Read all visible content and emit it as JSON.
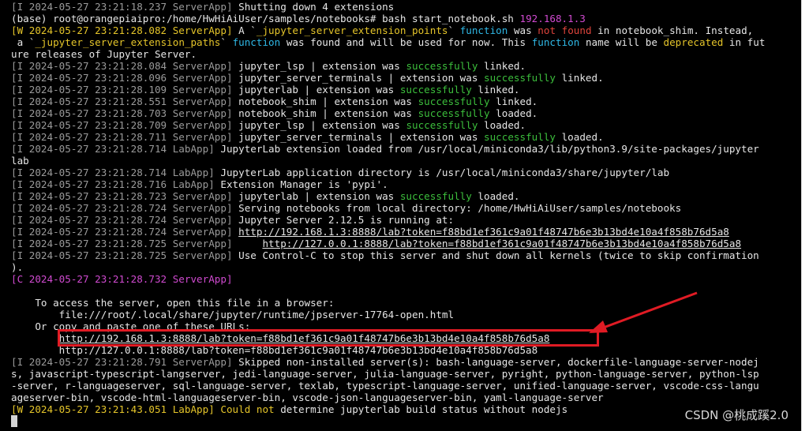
{
  "terminal": {
    "lines": [
      [
        {
          "t": "[I 2024-05-27 23:21:18.237 ServerApp] ",
          "c": "gray"
        },
        {
          "t": "Shutting down 4 extensions",
          "c": "white"
        }
      ],
      [
        {
          "t": "(base) root@orangepiaipro:/home/HwHiAiUser/samples/notebooks# bash start_notebook.sh ",
          "c": "white"
        },
        {
          "t": "192.168.1.3",
          "c": "mag"
        }
      ],
      [
        {
          "t": "[W 2024-05-27 23:21:28.082 ServerApp] ",
          "c": "yellow"
        },
        {
          "t": "A `",
          "c": "white"
        },
        {
          "t": "_jupyter_server_extension_points",
          "c": "yellow"
        },
        {
          "t": "` ",
          "c": "white"
        },
        {
          "t": "function",
          "c": "cyan"
        },
        {
          "t": " was ",
          "c": "white"
        },
        {
          "t": "not found",
          "c": "red"
        },
        {
          "t": " in notebook_shim. Instead,",
          "c": "white"
        }
      ],
      [
        {
          "t": " a `",
          "c": "white"
        },
        {
          "t": "_jupyter_server_extension_paths",
          "c": "yellow"
        },
        {
          "t": "` ",
          "c": "white"
        },
        {
          "t": "function",
          "c": "cyan"
        },
        {
          "t": " was found and will be used for now. This ",
          "c": "white"
        },
        {
          "t": "function",
          "c": "cyan"
        },
        {
          "t": " name will be ",
          "c": "white"
        },
        {
          "t": "deprecated",
          "c": "yellow"
        },
        {
          "t": " in fut",
          "c": "white"
        }
      ],
      [
        {
          "t": "ure releases of Jupyter Server.",
          "c": "white"
        }
      ],
      [
        {
          "t": "[I 2024-05-27 23:21:28.084 ServerApp] ",
          "c": "gray"
        },
        {
          "t": "jupyter_lsp | extension was ",
          "c": "white"
        },
        {
          "t": "successfully",
          "c": "green"
        },
        {
          "t": " linked.",
          "c": "white"
        }
      ],
      [
        {
          "t": "[I 2024-05-27 23:21:28.096 ServerApp] ",
          "c": "gray"
        },
        {
          "t": "jupyter_server_terminals | extension was ",
          "c": "white"
        },
        {
          "t": "successfully",
          "c": "green"
        },
        {
          "t": " linked.",
          "c": "white"
        }
      ],
      [
        {
          "t": "[I 2024-05-27 23:21:28.109 ServerApp] ",
          "c": "gray"
        },
        {
          "t": "jupyterlab | extension was ",
          "c": "white"
        },
        {
          "t": "successfully",
          "c": "green"
        },
        {
          "t": " linked.",
          "c": "white"
        }
      ],
      [
        {
          "t": "[I 2024-05-27 23:21:28.551 ServerApp] ",
          "c": "gray"
        },
        {
          "t": "notebook_shim | extension was ",
          "c": "white"
        },
        {
          "t": "successfully",
          "c": "green"
        },
        {
          "t": " linked.",
          "c": "white"
        }
      ],
      [
        {
          "t": "[I 2024-05-27 23:21:28.703 ServerApp] ",
          "c": "gray"
        },
        {
          "t": "notebook_shim | extension was ",
          "c": "white"
        },
        {
          "t": "successfully",
          "c": "green"
        },
        {
          "t": " loaded.",
          "c": "white"
        }
      ],
      [
        {
          "t": "[I 2024-05-27 23:21:28.709 ServerApp] ",
          "c": "gray"
        },
        {
          "t": "jupyter_lsp | extension was ",
          "c": "white"
        },
        {
          "t": "successfully",
          "c": "green"
        },
        {
          "t": " loaded.",
          "c": "white"
        }
      ],
      [
        {
          "t": "[I 2024-05-27 23:21:28.711 ServerApp] ",
          "c": "gray"
        },
        {
          "t": "jupyter_server_terminals | extension was ",
          "c": "white"
        },
        {
          "t": "successfully",
          "c": "green"
        },
        {
          "t": " loaded.",
          "c": "white"
        }
      ],
      [
        {
          "t": "[I 2024-05-27 23:21:28.714 LabApp] ",
          "c": "gray"
        },
        {
          "t": "JupyterLab extension loaded from /usr/local/miniconda3/lib/python3.9/site-packages/jupyter",
          "c": "white"
        }
      ],
      [
        {
          "t": "lab",
          "c": "white"
        }
      ],
      [
        {
          "t": "[I 2024-05-27 23:21:28.714 LabApp] ",
          "c": "gray"
        },
        {
          "t": "JupyterLab application directory is /usr/local/miniconda3/share/jupyter/lab",
          "c": "white"
        }
      ],
      [
        {
          "t": "[I 2024-05-27 23:21:28.716 LabApp] ",
          "c": "gray"
        },
        {
          "t": "Extension Manager is 'pypi'.",
          "c": "white"
        }
      ],
      [
        {
          "t": "[I 2024-05-27 23:21:28.723 ServerApp] ",
          "c": "gray"
        },
        {
          "t": "jupyterlab | extension was ",
          "c": "white"
        },
        {
          "t": "successfully",
          "c": "green"
        },
        {
          "t": " loaded.",
          "c": "white"
        }
      ],
      [
        {
          "t": "[I 2024-05-27 23:21:28.724 ServerApp] ",
          "c": "gray"
        },
        {
          "t": "Serving notebooks from local directory: /home/HwHiAiUser/samples/notebooks",
          "c": "white"
        }
      ],
      [
        {
          "t": "[I 2024-05-27 23:21:28.724 ServerApp] ",
          "c": "gray"
        },
        {
          "t": "Jupyter Server 2.12.5 is running at:",
          "c": "white"
        }
      ],
      [
        {
          "t": "[I 2024-05-27 23:21:28.724 ServerApp] ",
          "c": "gray"
        },
        {
          "t": "http://192.168.1.3:8888/lab?token=f88bd1ef361c9a01f48747b6e3b13bd4e10a4f858b76d5a8",
          "c": "url"
        }
      ],
      [
        {
          "t": "[I 2024-05-27 23:21:28.725 ServerApp] ",
          "c": "gray"
        },
        {
          "t": "    ",
          "c": "white"
        },
        {
          "t": "http://127.0.0.1:8888/lab?token=f88bd1ef361c9a01f48747b6e3b13bd4e10a4f858b76d5a8",
          "c": "url"
        }
      ],
      [
        {
          "t": "[I 2024-05-27 23:21:28.725 ServerApp] ",
          "c": "gray"
        },
        {
          "t": "Use Control-C to stop this server and shut down all kernels (twice to skip confirmation",
          "c": "white"
        }
      ],
      [
        {
          "t": ").",
          "c": "white"
        }
      ],
      [
        {
          "t": "[C 2024-05-27 23:21:28.732 ServerApp] ",
          "c": "mag"
        }
      ],
      [
        {
          "t": "",
          "c": "white"
        }
      ],
      [
        {
          "t": "    To access the server, open this file in a browser:",
          "c": "white"
        }
      ],
      [
        {
          "t": "        file:///root/.local/share/jupyter/runtime/jpserver-17764-open.html",
          "c": "white"
        }
      ],
      [
        {
          "t": "    Or copy and paste one of these URLs:",
          "c": "white"
        }
      ],
      [
        {
          "t": "        ",
          "c": "white"
        },
        {
          "t": "http://192.168.1.3:8888/lab?token=f88bd1ef361c9a01f48747b6e3b13bd4e10a4f858b76d5a8",
          "c": "url"
        }
      ],
      [
        {
          "t": "        http://127.0.0.1:8888/lab?token=f88bd1ef361c9a01f48747b6e3b13bd4e10a4f858b76d5a8",
          "c": "white"
        }
      ],
      [
        {
          "t": "[I 2024-05-27 23:21:28.791 ServerApp] ",
          "c": "gray"
        },
        {
          "t": "Skipped non-installed server(s): bash-language-server, dockerfile-language-server-nodej",
          "c": "white"
        }
      ],
      [
        {
          "t": "s, javascript-typescript-langserver, jedi-language-server, julia-language-server, pyright, python-language-server, python-lsp",
          "c": "white"
        }
      ],
      [
        {
          "t": "-server, r-languageserver, sql-language-server, texlab, typescript-language-server, unified-language-server, vscode-css-langu",
          "c": "white"
        }
      ],
      [
        {
          "t": "ageserver-bin, vscode-html-languageserver-bin, vscode-json-languageserver-bin, yaml-language-server",
          "c": "white"
        }
      ],
      [
        {
          "t": "[W 2024-05-27 23:21:43.051 LabApp] ",
          "c": "yellow"
        },
        {
          "t": "Could not",
          "c": "yellow"
        },
        {
          "t": " determine jupyterlab build status without nodejs",
          "c": "white"
        }
      ]
    ]
  },
  "watermark": "CSDN @桃成蹊2.0",
  "colors": {
    "annotation_red": "#e01b24",
    "terminal_bg": "#000000"
  }
}
